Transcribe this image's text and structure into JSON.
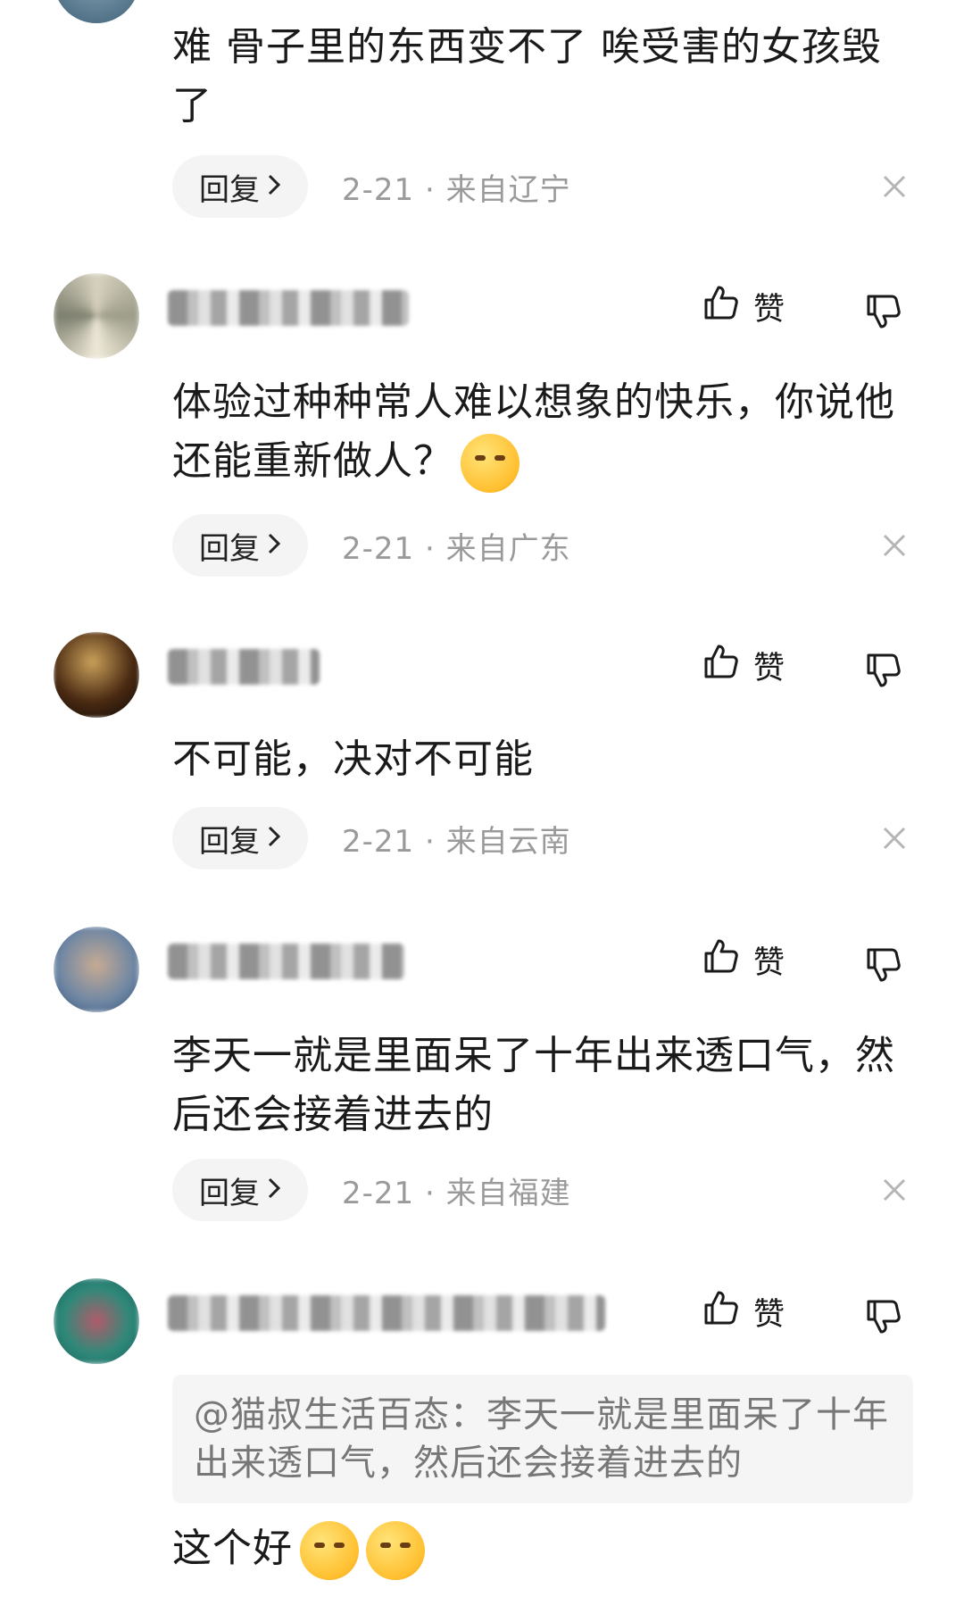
{
  "labels": {
    "reply": "回复",
    "like": "赞"
  },
  "comments": [
    {
      "text": "难 骨子里的东西变不了 唉受害的女孩毁了",
      "date": "2-21",
      "sep": "·",
      "location": "来自辽宁"
    },
    {
      "text": "体验过种种常人难以想象的快乐，你说他还能重新做人？",
      "emoji": "smirk-emoji",
      "date": "2-21",
      "sep": "·",
      "location": "来自广东"
    },
    {
      "text": "不可能，决对不可能",
      "date": "2-21",
      "sep": "·",
      "location": "来自云南"
    },
    {
      "text": "李天一就是里面呆了十年出来透口气，然后还会接着进去的",
      "date": "2-21",
      "sep": "·",
      "location": "来自福建"
    },
    {
      "quote": "@猫叔生活百态：李天一就是里面呆了十年出来透口气，然后还会接着进去的",
      "text": "这个好"
    }
  ],
  "colors": {
    "meta": "#9a9a9a",
    "reply_bg": "#f4f4f4",
    "quote_bg": "#f5f5f5"
  }
}
